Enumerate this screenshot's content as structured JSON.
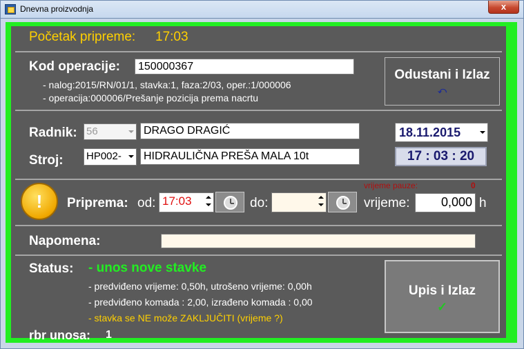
{
  "window": {
    "title": "Dnevna proizvodnja",
    "close_glyph": "x"
  },
  "header": {
    "start_label": "Početak pripreme:",
    "start_time": "17:03"
  },
  "operation": {
    "label": "Kod operacije:",
    "code": "150000367",
    "detail_line1": "- nalog:2015/RN/01/1, stavka:1, faza:2/03, oper.:1/000006",
    "detail_line2": "- operacija:000006/Prešanje pozicija prema nacrtu"
  },
  "cancel_button": {
    "label": "Odustani i Izlaz",
    "icon": "undo-arrow-icon",
    "icon_glyph": "⤺"
  },
  "worker": {
    "label": "Radnik:",
    "id": "56",
    "name": "DRAGO DRAGIĆ"
  },
  "machine": {
    "label": "Stroj:",
    "id": "HP002-",
    "name": "HIDRAULIČNA PREŠA MALA 10t"
  },
  "date": {
    "value": "18.11.2015"
  },
  "clock": {
    "value": "17 : 03 : 20"
  },
  "prep": {
    "warning_icon": "warning-icon",
    "warning_glyph": "!",
    "label": "Priprema:",
    "from_label": "od:",
    "from_value": "17:03",
    "to_label": "do:",
    "to_value": "",
    "pause_label": "vrijeme pauze:",
    "pause_value": "0",
    "time_label": "vrijeme:",
    "time_value": "0,000",
    "time_unit": "h"
  },
  "note": {
    "label": "Napomena:",
    "value": ""
  },
  "status": {
    "label": "Status:",
    "value": "- unos nove stavke",
    "line1": "- predviđeno vrijeme: 0,50h,  utrošeno vrijeme: 0,00h",
    "line2": "- predviđeno komada : 2,00,  izrađeno komada : 0,00",
    "warning": "- stavka se NE može ZAKLJUČITI (vrijeme ?)"
  },
  "entry": {
    "label": "rbr unosa:",
    "value": "1"
  },
  "save_button": {
    "label": "Upis i Izlaz",
    "icon": "checkmark-icon",
    "icon_glyph": "✓"
  },
  "colors": {
    "border_green": "#22ee22",
    "panel": "#5a5a5a",
    "accent_yellow": "#ffd000",
    "status_green": "#22ee22",
    "time_red": "#e01010",
    "date_blue": "#1a1a6e"
  }
}
